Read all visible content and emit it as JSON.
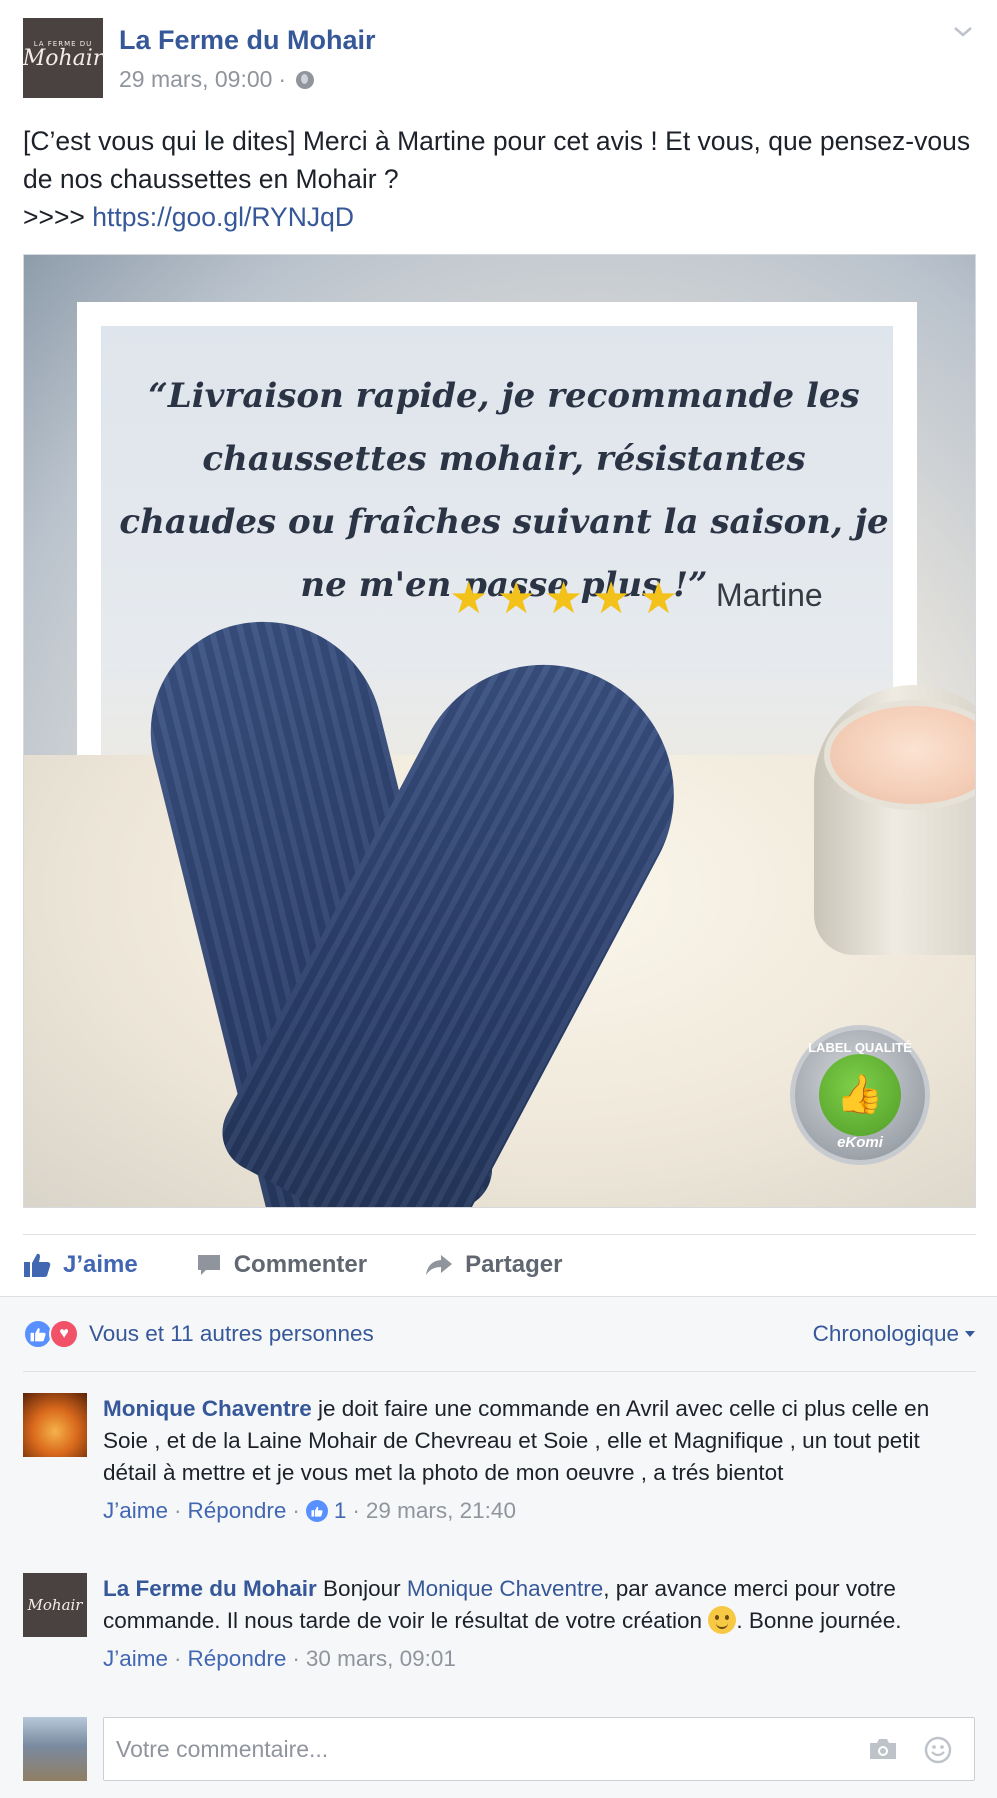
{
  "post": {
    "page_name": "La Ferme du Mohair",
    "avatar_text": "Mohair",
    "avatar_small_text": "LA FERME DU",
    "timestamp": "29 mars, 09:00",
    "meta_separator": "·",
    "privacy_icon": "globe-icon",
    "menu_icon": "chevron-down-icon",
    "text_line1": "[C’est vous qui le dites] Merci à Martine pour cet avis ! Et vous, que pensez-vous de nos chaussettes en Mohair ?",
    "text_prefix": ">>>> ",
    "link": "https://goo.gl/RYNJqD"
  },
  "image": {
    "quote": "“Livraison rapide, je recommande les chaussettes mohair, résistantes chaudes ou fraîches suivant la saison, je ne m'en passe plus !”",
    "stars": "★★★★★",
    "rating": 5,
    "reviewer": "Martine",
    "badge_top": "LABEL QUALITÉ",
    "badge_bottom": "eKomi"
  },
  "actions": {
    "like": "J’aime",
    "comment": "Commenter",
    "share": "Partager"
  },
  "reactions": {
    "summary": "Vous et 11 autres personnes",
    "sort_label": "Chronologique"
  },
  "comments": [
    {
      "author": "Monique Chaventre",
      "text": " je doit faire une commande en Avril avec celle ci plus celle en Soie , et de la Laine Mohair de Chevreau et Soie , elle et Magnifique , un tout petit détail à mettre et je vous met la photo de mon oeuvre , a trés bientot",
      "like_label": "J’aime",
      "reply_label": "Répondre",
      "like_count": "1",
      "time": "29 mars, 21:40",
      "sep": "·"
    },
    {
      "author": "La Ferme du Mohair",
      "avatar_text": "Mohair",
      "text_before": " Bonjour ",
      "mention": "Monique Chaventre",
      "text_after": ", par avance merci pour votre commande. Il nous tarde de voir le résultat de votre création ",
      "text_end": ". Bonne journée.",
      "like_label": "J’aime",
      "reply_label": "Répondre",
      "time": "30 mars, 09:01",
      "sep": "·"
    }
  ],
  "composer": {
    "placeholder": "Votre commentaire..."
  },
  "colors": {
    "link": "#365899",
    "like_blue": "#4267b2",
    "meta_gray": "#90949c",
    "comments_bg": "#f6f7f9",
    "love_red": "#f25268",
    "star_gold": "#f3c21a"
  }
}
